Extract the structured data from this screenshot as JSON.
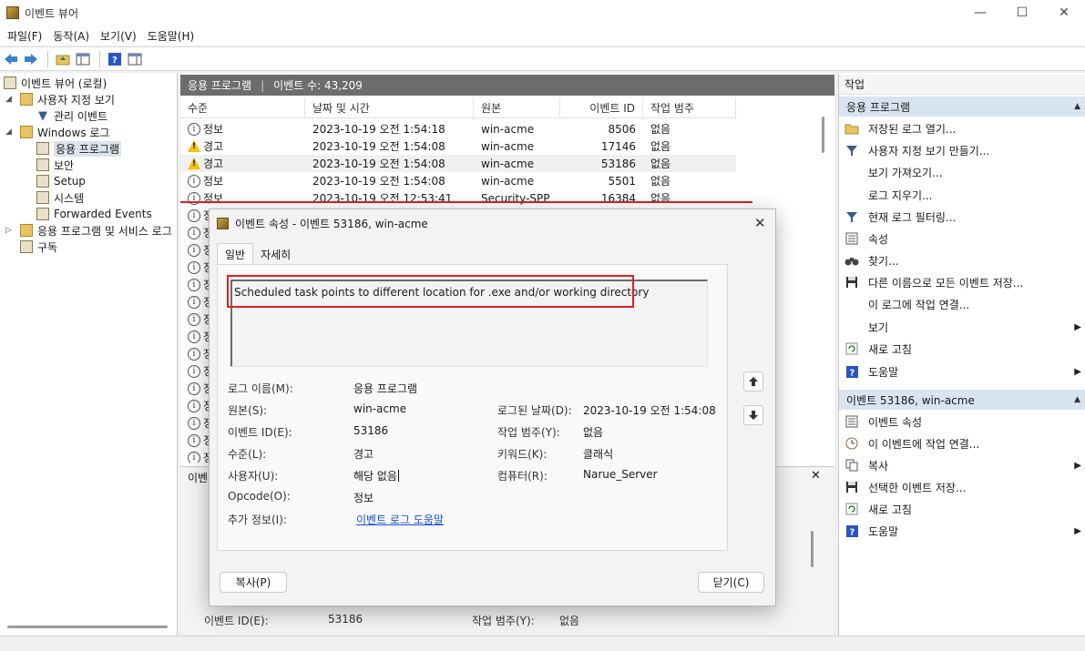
{
  "window": {
    "title": "이벤트 뷰어",
    "minimize": "—",
    "maximize": "☐",
    "close": "✕"
  },
  "menu": [
    "파일(F)",
    "동작(A)",
    "보기(V)",
    "도움말(H)"
  ],
  "tree": {
    "root": "이벤트 뷰어 (로컬)",
    "custom_views": "사용자 지정 보기",
    "admin_events": "관리 이벤트",
    "windows_logs": "Windows 로그",
    "application": "응용 프로그램",
    "security": "보안",
    "setup": "Setup",
    "system": "시스템",
    "forwarded": "Forwarded Events",
    "apps_services": "응용 프로그램 및 서비스 로그",
    "subscriptions": "구독"
  },
  "center": {
    "log_name": "응용 프로그램",
    "event_count_label": "이벤트 수: 43,209",
    "columns": [
      "수준",
      "날짜 및 시간",
      "원본",
      "이벤트 ID",
      "작업 범주"
    ],
    "rows": [
      {
        "level": "정보",
        "type": "info",
        "date": "2023-10-19 오전 1:54:18",
        "source": "win-acme",
        "id": "8506",
        "category": "없음"
      },
      {
        "level": "경고",
        "type": "warn",
        "date": "2023-10-19 오전 1:54:08",
        "source": "win-acme",
        "id": "17146",
        "category": "없음"
      },
      {
        "level": "경고",
        "type": "warn",
        "date": "2023-10-19 오전 1:54:08",
        "source": "win-acme",
        "id": "53186",
        "category": "없음"
      },
      {
        "level": "정보",
        "type": "info",
        "date": "2023-10-19 오전 1:54:08",
        "source": "win-acme",
        "id": "5501",
        "category": "없음"
      },
      {
        "level": "정보",
        "type": "info",
        "date": "2023-10-19 오전 12:53:41",
        "source": "Security-SPP",
        "id": "16384",
        "category": "없음"
      },
      {
        "level": "정",
        "type": "info"
      },
      {
        "level": "정",
        "type": "info"
      },
      {
        "level": "정",
        "type": "info"
      },
      {
        "level": "정",
        "type": "info"
      },
      {
        "level": "정",
        "type": "info"
      },
      {
        "level": "정",
        "type": "info"
      },
      {
        "level": "정",
        "type": "info"
      },
      {
        "level": "정",
        "type": "info"
      },
      {
        "level": "정",
        "type": "info"
      },
      {
        "level": "정",
        "type": "info"
      },
      {
        "level": "정",
        "type": "info"
      },
      {
        "level": "정",
        "type": "info"
      },
      {
        "level": "정",
        "type": "info"
      },
      {
        "level": "정",
        "type": "info"
      },
      {
        "level": "정",
        "type": "info"
      }
    ],
    "preview_tab": "이벤",
    "preview_close": "✕",
    "preview_id_label": "이벤트 ID(E):",
    "preview_id_value": "53186",
    "preview_cat_label": "작업 범주(Y):",
    "preview_cat_value": "없음"
  },
  "actions": {
    "title": "작업",
    "section1": "응용 프로그램",
    "items1": [
      {
        "label": "저장된 로그 열기...",
        "icon": "open-folder-icon"
      },
      {
        "label": "사용자 지정 보기 만들기...",
        "icon": "filter-icon"
      },
      {
        "label": "보기 가져오기...",
        "icon": ""
      },
      {
        "label": "로그 지우기...",
        "icon": ""
      },
      {
        "label": "현재 로그 필터링...",
        "icon": "filter-icon"
      },
      {
        "label": "속성",
        "icon": "properties-icon"
      },
      {
        "label": "찾기...",
        "icon": "binoculars-icon"
      },
      {
        "label": "다른 이름으로 모든 이벤트 저장...",
        "icon": "save-icon"
      },
      {
        "label": "이 로그에 작업 연결...",
        "icon": ""
      },
      {
        "label": "보기",
        "icon": "",
        "submenu": true
      },
      {
        "label": "새로 고침",
        "icon": "refresh-icon"
      },
      {
        "label": "도움말",
        "icon": "help-icon",
        "submenu": true
      }
    ],
    "section2": "이벤트 53186, win-acme",
    "items2": [
      {
        "label": "이벤트 속성",
        "icon": "properties-icon"
      },
      {
        "label": "이 이벤트에 작업 연결...",
        "icon": "clock-icon"
      },
      {
        "label": "복사",
        "icon": "copy-icon",
        "submenu": true
      },
      {
        "label": "선택한 이벤트 저장...",
        "icon": "save-icon"
      },
      {
        "label": "새로 고침",
        "icon": "refresh-icon"
      },
      {
        "label": "도움말",
        "icon": "help-icon",
        "submenu": true
      }
    ]
  },
  "dialog": {
    "title": "이벤트 속성 - 이벤트 53186, win-acme",
    "close": "✕",
    "tab_general": "일반",
    "tab_details": "자세히",
    "description": "Scheduled task points to different location for .exe and/or working directory",
    "fields": {
      "log_name_label": "로그 이름(M):",
      "log_name_value": "응용 프로그램",
      "source_label": "원본(S):",
      "source_value": "win-acme",
      "logged_label": "로그된 날짜(D):",
      "logged_value": "2023-10-19 오전 1:54:08",
      "event_id_label": "이벤트 ID(E):",
      "event_id_value": "53186",
      "category_label": "작업 범주(Y):",
      "category_value": "없음",
      "level_label": "수준(L):",
      "level_value": "경고",
      "keywords_label": "키워드(K):",
      "keywords_value": "클래식",
      "user_label": "사용자(U):",
      "user_value": "해당 없음",
      "computer_label": "컴퓨터(R):",
      "computer_value": "Narue_Server",
      "opcode_label": "Opcode(O):",
      "opcode_value": "정보",
      "more_info_label": "추가 정보(I):",
      "more_info_link": "이벤트 로그 도움말"
    },
    "copy_button": "복사(P)",
    "close_button": "닫기(C)"
  },
  "colors": {
    "highlight_red": "#e02020",
    "section_blue": "#d9e4f1",
    "header_gray": "#6d6d6d",
    "link_blue": "#1a4fd6"
  }
}
